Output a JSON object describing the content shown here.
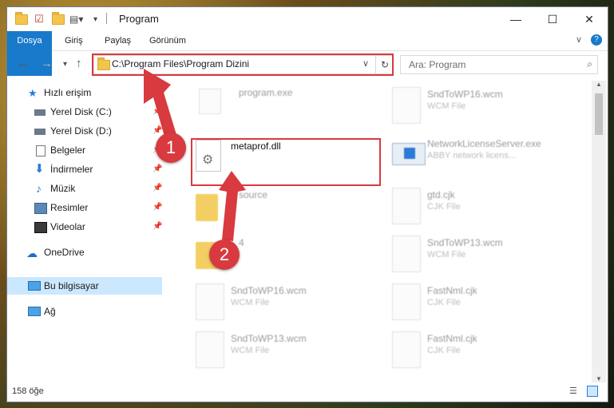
{
  "window": {
    "title": "Program"
  },
  "ribbon": {
    "tabs": [
      "Dosya",
      "Giriş",
      "Paylaş",
      "Görünüm"
    ]
  },
  "address": {
    "path": "C:\\Program Files\\Program Dizini"
  },
  "search": {
    "placeholder": "Ara: Program"
  },
  "nav": {
    "items": [
      {
        "label": "Hızlı erişim",
        "icon": "star-icon"
      },
      {
        "label": "Yerel Disk (C:)",
        "icon": "drive-icon",
        "pinned": true
      },
      {
        "label": "Yerel Disk (D:)",
        "icon": "drive-icon",
        "pinned": true
      },
      {
        "label": "Belgeler",
        "icon": "documents-icon",
        "pinned": true
      },
      {
        "label": "İndirmeler",
        "icon": "download-icon",
        "pinned": true
      },
      {
        "label": "Müzik",
        "icon": "music-icon",
        "pinned": true
      },
      {
        "label": "Resimler",
        "icon": "pictures-icon",
        "pinned": true
      },
      {
        "label": "Videolar",
        "icon": "video-icon",
        "pinned": true
      },
      {
        "label": "OneDrive",
        "icon": "cloud-icon"
      },
      {
        "label": "Bu bilgisayar",
        "icon": "computer-icon",
        "selected": true
      },
      {
        "label": "Ağ",
        "icon": "network-icon"
      }
    ]
  },
  "files": {
    "left": [
      {
        "name": "program.exe",
        "type": ""
      },
      {
        "name": "metaprof.dll",
        "type": ""
      },
      {
        "name": "source",
        "type": ""
      },
      {
        "name": "4",
        "type": ""
      },
      {
        "name": "SndToWP16.wcm",
        "type": "WCM File"
      },
      {
        "name": "SndToWP13.wcm",
        "type": "WCM File"
      }
    ],
    "right": [
      {
        "name": "SndToWP16.wcm",
        "type": "WCM File"
      },
      {
        "name": "NetworkLicenseServer.exe",
        "type": "ABBY network licens..."
      },
      {
        "name": "gtd.cjk",
        "type": "CJK File"
      },
      {
        "name": "SndToWP13.wcm",
        "type": "WCM File"
      },
      {
        "name": "FastNml.cjk",
        "type": "CJK File"
      },
      {
        "name": "FastNml.cjk",
        "type": "CJK File"
      }
    ]
  },
  "status": {
    "count": "158 öğe"
  },
  "annotations": {
    "step1": "1",
    "step2": "2"
  },
  "colors": {
    "accent": "#1979ca",
    "highlight": "#d83a3f"
  }
}
